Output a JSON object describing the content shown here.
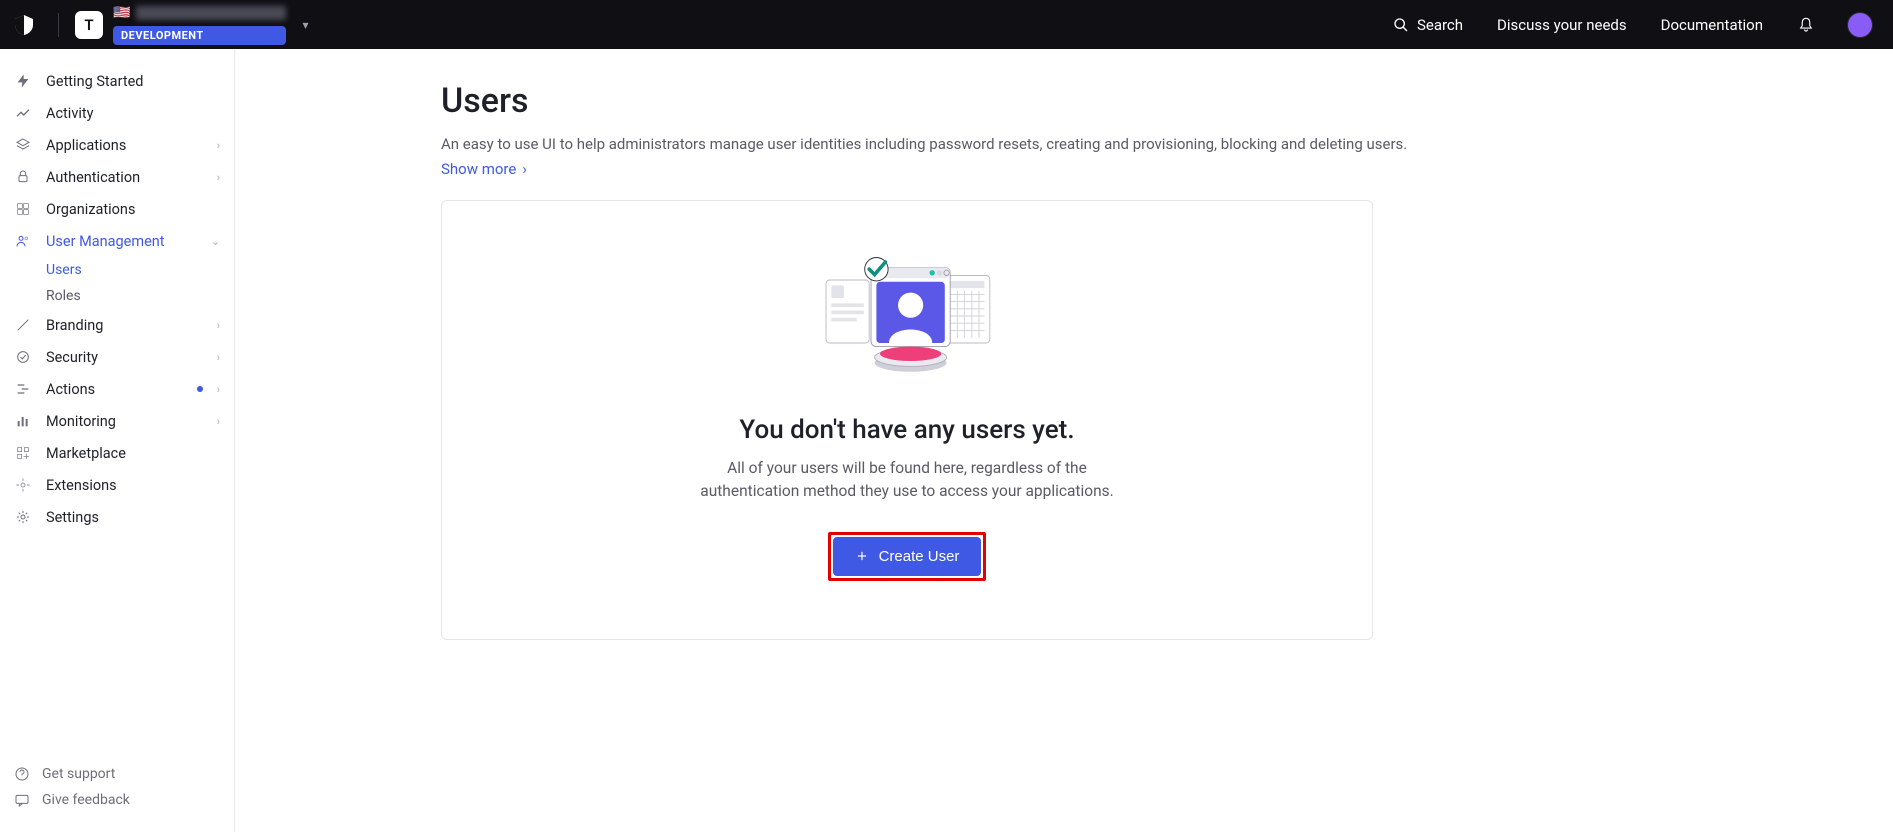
{
  "header": {
    "tenant_initial": "T",
    "env_tag": "DEVELOPMENT",
    "search_label": "Search",
    "nav": {
      "discuss": "Discuss your needs",
      "docs": "Documentation"
    }
  },
  "sidebar": {
    "items": [
      {
        "label": "Getting Started",
        "icon": "bolt",
        "expandable": false
      },
      {
        "label": "Activity",
        "icon": "trend",
        "expandable": false
      },
      {
        "label": "Applications",
        "icon": "layers",
        "expandable": true
      },
      {
        "label": "Authentication",
        "icon": "lock",
        "expandable": true
      },
      {
        "label": "Organizations",
        "icon": "org",
        "expandable": false
      },
      {
        "label": "User Management",
        "icon": "users",
        "expandable": true,
        "active": true,
        "open": true,
        "children": [
          {
            "label": "Users",
            "active": true
          },
          {
            "label": "Roles",
            "active": false
          }
        ]
      },
      {
        "label": "Branding",
        "icon": "brush",
        "expandable": true
      },
      {
        "label": "Security",
        "icon": "shield",
        "expandable": true
      },
      {
        "label": "Actions",
        "icon": "flow",
        "expandable": true,
        "dot": true
      },
      {
        "label": "Monitoring",
        "icon": "bars",
        "expandable": true
      },
      {
        "label": "Marketplace",
        "icon": "grid",
        "expandable": false
      },
      {
        "label": "Extensions",
        "icon": "puzzle",
        "expandable": false
      },
      {
        "label": "Settings",
        "icon": "gear",
        "expandable": false
      }
    ],
    "footer": {
      "support": "Get support",
      "feedback": "Give feedback"
    }
  },
  "main": {
    "title": "Users",
    "description": "An easy to use UI to help administrators manage user identities including password resets, creating and provisioning, blocking and deleting users.",
    "show_more": "Show more",
    "empty": {
      "title": "You don't have any users yet.",
      "desc": "All of your users will be found here, regardless of the authentication method they use to access your applications.",
      "button": "Create User"
    }
  }
}
